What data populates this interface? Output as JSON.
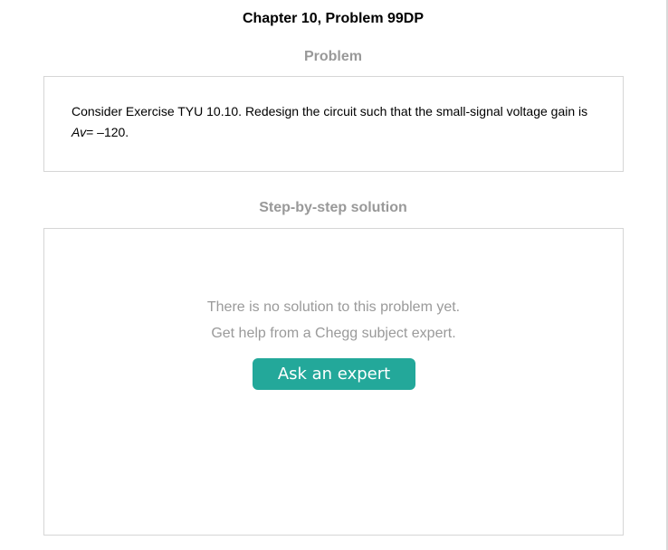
{
  "header": {
    "chapter_title": "Chapter 10, Problem 99DP"
  },
  "problem": {
    "heading": "Problem",
    "text": "Consider Exercise TYU 10.10. Redesign the circuit such that the small-signal voltage gain is",
    "gain_symbol": "Av",
    "gain_value": "= –120."
  },
  "solution": {
    "heading": "Step-by-step solution",
    "no_solution_line1": "There is no solution to this problem yet.",
    "no_solution_line2": "Get help from a Chegg subject expert.",
    "ask_button_label": "Ask an expert"
  },
  "colors": {
    "accent": "#23a89a",
    "heading_gray": "#999999",
    "border": "#d6d6d6"
  }
}
